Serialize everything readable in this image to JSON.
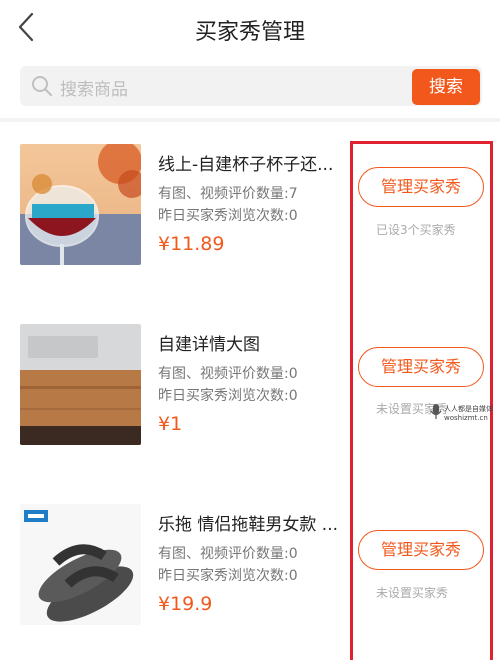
{
  "header": {
    "title": "买家秀管理",
    "back_icon": "chevron-left-icon"
  },
  "search": {
    "placeholder": "搜索商品",
    "button_label": "搜索"
  },
  "colors": {
    "accent": "#f2581c",
    "highlight_box": "#e0212f"
  },
  "products": [
    {
      "name": "线上-自建杯子杯子还...",
      "review_count_line": "有图、视频评价数量:7",
      "views_line": "昨日买家秀浏览次数:0",
      "price": "¥11.89",
      "manage_label": "管理买家秀",
      "status": "已设3个买家秀"
    },
    {
      "name": "自建详情大图",
      "review_count_line": "有图、视频评价数量:0",
      "views_line": "昨日买家秀浏览次数:0",
      "price": "¥1",
      "manage_label": "管理买家秀",
      "status": "未设置买家秀"
    },
    {
      "name": "乐拖 情侣拖鞋男女款 ...",
      "review_count_line": "有图、视频评价数量:0",
      "views_line": "昨日买家秀浏览次数:0",
      "price": "¥19.9",
      "manage_label": "管理买家秀",
      "status": "未设置买家秀"
    }
  ],
  "watermark": {
    "line1": "人人都是自媒体",
    "line2": "woshizmt.cn"
  }
}
